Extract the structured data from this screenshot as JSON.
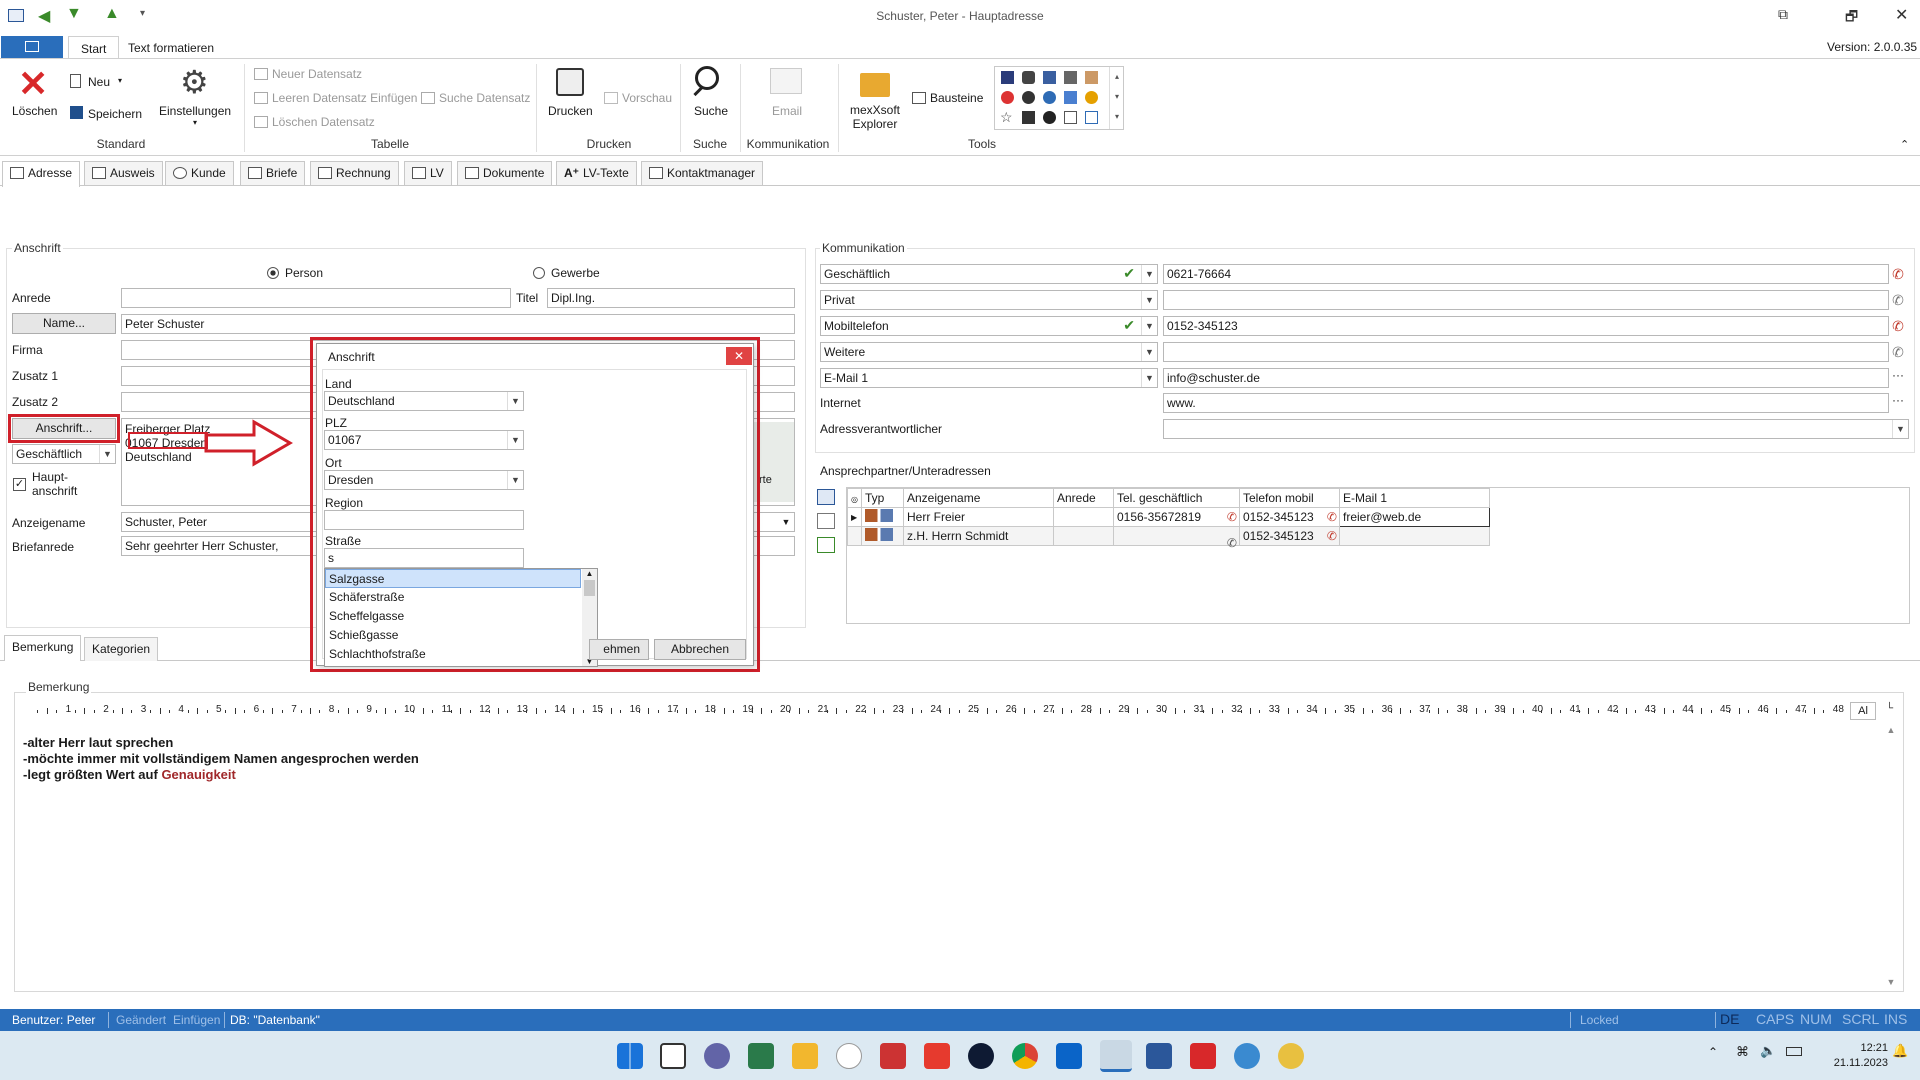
{
  "window": {
    "title": "Schuster, Peter - Hauptadresse",
    "version": "Version: 2.0.0.35"
  },
  "ribbon": {
    "tabs": [
      "Start",
      "Text formatieren"
    ],
    "standard": {
      "loeschen": "Löschen",
      "neu": "Neu",
      "speichern": "Speichern",
      "einstellungen": "Einstellungen",
      "group": "Standard"
    },
    "tabelle": {
      "neuer": "Neuer Datensatz",
      "leeren": "Leeren Datensatz Einfügen",
      "suche": "Suche Datensatz",
      "loeschen": "Löschen Datensatz",
      "group": "Tabelle"
    },
    "drucken": {
      "drucken": "Drucken",
      "vorschau": "Vorschau",
      "group": "Drucken"
    },
    "suche": {
      "suche": "Suche",
      "group": "Suche"
    },
    "kommunikation": {
      "email": "Email",
      "group": "Kommunikation"
    },
    "tools": {
      "explorer1": "mexXsoft",
      "explorer2": "Explorer",
      "bausteine": "Bausteine",
      "group": "Tools"
    }
  },
  "tabs": [
    "Adresse",
    "Ausweis",
    "Kunde",
    "Briefe",
    "Rechnung",
    "LV",
    "Dokumente",
    "LV-Texte",
    "Kontaktmanager"
  ],
  "anschrift": {
    "section": "Anschrift",
    "person": "Person",
    "gewerbe": "Gewerbe",
    "anrede_label": "Anrede",
    "titel_label": "Titel",
    "titel_value": "Dipl.Ing.",
    "name_button": "Name...",
    "name_value": "Peter Schuster",
    "firma": "Firma",
    "zusatz1": "Zusatz 1",
    "zusatz2": "Zusatz 2",
    "anschrift_button": "Anschrift...",
    "addr1": "Freiberger Platz",
    "addr2": "01067 Dresden",
    "addr3": "Deutschland",
    "type": "Geschäftlich",
    "haupt1": "Haupt-",
    "haupt2": "anschrift",
    "anzeigename_label": "Anzeigename",
    "anzeigename_value": "Schuster, Peter",
    "briefanrede_label": "Briefanrede",
    "briefanrede_value": "Sehr geehrter Herr Schuster,",
    "partial": "rte"
  },
  "dialog": {
    "title": "Anschrift",
    "land_label": "Land",
    "land_value": "Deutschland",
    "plz_label": "PLZ",
    "plz_value": "01067",
    "ort_label": "Ort",
    "ort_value": "Dresden",
    "region_label": "Region",
    "strasse_label": "Straße",
    "strasse_value": "s",
    "suggestions": [
      "Salzgasse",
      "Schäferstraße",
      "Scheffelgasse",
      "Schießgasse",
      "Schlachthofstraße"
    ],
    "ok": "Übernehmen",
    "ok_partial": "ehmen",
    "cancel": "Abbrechen"
  },
  "kommunikation": {
    "section": "Kommunikation",
    "rows": [
      {
        "type": "Geschäftlich",
        "value": "0621-76664"
      },
      {
        "type": "Privat",
        "value": ""
      },
      {
        "type": "Mobiltelefon",
        "value": "0152-345123"
      },
      {
        "type": "Weitere",
        "value": ""
      },
      {
        "type": "E-Mail 1",
        "value": "info@schuster.de"
      }
    ],
    "internet_label": "Internet",
    "internet_value": "www.",
    "adressverantwortlicher": "Adressverantwortlicher"
  },
  "ansprech": {
    "section": "Ansprechpartner/Unteradressen",
    "headers": [
      "Typ",
      "Anzeigename",
      "Anrede",
      "Tel. geschäftlich",
      "Telefon mobil",
      "E-Mail 1"
    ],
    "rows": [
      {
        "name": "Herr Freier",
        "anrede": "",
        "tel": "0156-35672819",
        "mobil": "0152-345123",
        "email": "freier@web.de"
      },
      {
        "name": "z.H. Herrn Schmidt",
        "anrede": "",
        "tel": "",
        "mobil": "0152-345123",
        "email": ""
      }
    ]
  },
  "bottom_tabs": [
    "Bemerkung",
    "Kategorien"
  ],
  "bemerkung": {
    "label": "Bemerkung",
    "line1": "-alter Herr laut sprechen",
    "line2": "-möchte immer mit vollständigem Namen angesprochen werden",
    "line3a": "-legt größten Wert auf ",
    "line3b": "Genauigkeit",
    "ruler_end": "Al"
  },
  "status": {
    "benutzer": "Benutzer: Peter",
    "geaendert": "Geändert",
    "einfuegen": "Einfügen",
    "db": "DB: \"Datenbank\"",
    "locked": "Locked",
    "de": "DE",
    "caps": "CAPS",
    "num": "NUM",
    "scrl": "SCRL",
    "ins": "INS"
  },
  "taskbar": {
    "time": "12:21",
    "date": "21.11.2023"
  }
}
